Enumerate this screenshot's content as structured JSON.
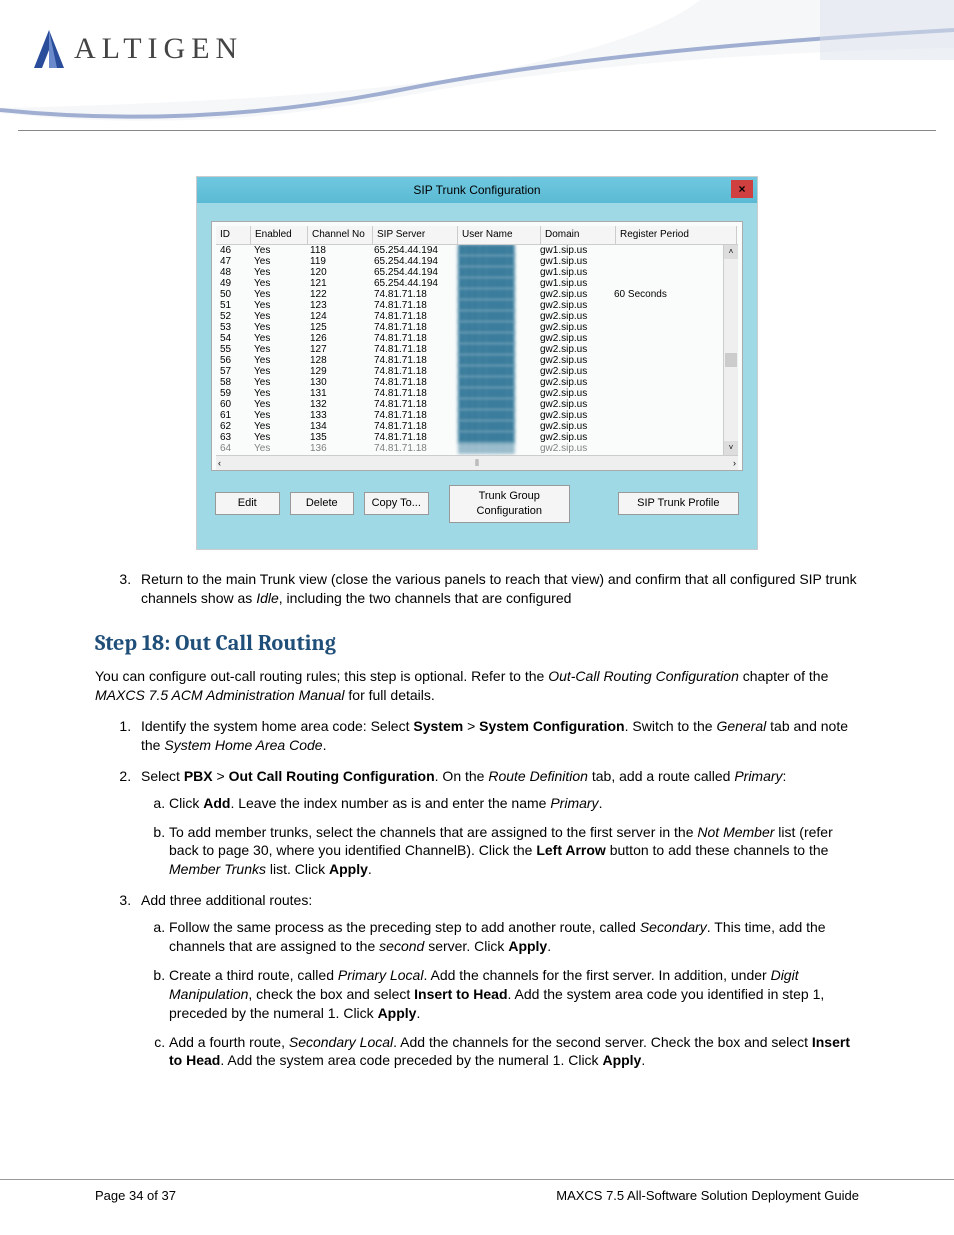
{
  "dialog": {
    "title": "SIP Trunk Configuration",
    "close": "×",
    "columns": [
      "ID",
      "Enabled",
      "Channel No",
      "SIP Server",
      "User Name",
      "Domain",
      "Register Period"
    ],
    "rows": [
      {
        "id": "46",
        "en": "Yes",
        "ch": "118",
        "sip": "65.254.44.194",
        "dom": "gw1.sip.us",
        "reg": ""
      },
      {
        "id": "47",
        "en": "Yes",
        "ch": "119",
        "sip": "65.254.44.194",
        "dom": "gw1.sip.us",
        "reg": ""
      },
      {
        "id": "48",
        "en": "Yes",
        "ch": "120",
        "sip": "65.254.44.194",
        "dom": "gw1.sip.us",
        "reg": ""
      },
      {
        "id": "49",
        "en": "Yes",
        "ch": "121",
        "sip": "65.254.44.194",
        "dom": "gw1.sip.us",
        "reg": ""
      },
      {
        "id": "50",
        "en": "Yes",
        "ch": "122",
        "sip": "74.81.71.18",
        "dom": "gw2.sip.us",
        "reg": "60 Seconds"
      },
      {
        "id": "51",
        "en": "Yes",
        "ch": "123",
        "sip": "74.81.71.18",
        "dom": "gw2.sip.us",
        "reg": ""
      },
      {
        "id": "52",
        "en": "Yes",
        "ch": "124",
        "sip": "74.81.71.18",
        "dom": "gw2.sip.us",
        "reg": ""
      },
      {
        "id": "53",
        "en": "Yes",
        "ch": "125",
        "sip": "74.81.71.18",
        "dom": "gw2.sip.us",
        "reg": ""
      },
      {
        "id": "54",
        "en": "Yes",
        "ch": "126",
        "sip": "74.81.71.18",
        "dom": "gw2.sip.us",
        "reg": ""
      },
      {
        "id": "55",
        "en": "Yes",
        "ch": "127",
        "sip": "74.81.71.18",
        "dom": "gw2.sip.us",
        "reg": ""
      },
      {
        "id": "56",
        "en": "Yes",
        "ch": "128",
        "sip": "74.81.71.18",
        "dom": "gw2.sip.us",
        "reg": ""
      },
      {
        "id": "57",
        "en": "Yes",
        "ch": "129",
        "sip": "74.81.71.18",
        "dom": "gw2.sip.us",
        "reg": ""
      },
      {
        "id": "58",
        "en": "Yes",
        "ch": "130",
        "sip": "74.81.71.18",
        "dom": "gw2.sip.us",
        "reg": ""
      },
      {
        "id": "59",
        "en": "Yes",
        "ch": "131",
        "sip": "74.81.71.18",
        "dom": "gw2.sip.us",
        "reg": ""
      },
      {
        "id": "60",
        "en": "Yes",
        "ch": "132",
        "sip": "74.81.71.18",
        "dom": "gw2.sip.us",
        "reg": ""
      },
      {
        "id": "61",
        "en": "Yes",
        "ch": "133",
        "sip": "74.81.71.18",
        "dom": "gw2.sip.us",
        "reg": ""
      },
      {
        "id": "62",
        "en": "Yes",
        "ch": "134",
        "sip": "74.81.71.18",
        "dom": "gw2.sip.us",
        "reg": ""
      },
      {
        "id": "63",
        "en": "Yes",
        "ch": "135",
        "sip": "74.81.71.18",
        "dom": "gw2.sip.us",
        "reg": ""
      },
      {
        "id": "64",
        "en": "Yes",
        "ch": "136",
        "sip": "74.81.71.18",
        "dom": "gw2.sip.us",
        "reg": ""
      }
    ],
    "buttons": {
      "edit": "Edit",
      "delete": "Delete",
      "copyto": "Copy To...",
      "trunkgroup": "Trunk Group Configuration",
      "profile": "SIP Trunk Profile"
    },
    "scroll": {
      "up": "˄",
      "down": "˅",
      "left": "‹",
      "right": "›",
      "mid": "⦀"
    }
  },
  "body": {
    "item3_a": "Return to the main Trunk view (close the various panels to reach that view) and confirm that all configured SIP trunk channels show as ",
    "item3_idle": "Idle",
    "item3_b": ", including the two channels that are configured",
    "step_title": "Step 18: Out Call Routing",
    "intro_a": "You can configure out-call routing rules; this step is optional. Refer to the ",
    "intro_i": "Out-Call Routing Configuration",
    "intro_b": " chapter of the ",
    "intro_i2": "MAXCS 7.5 ACM Administration Manual",
    "intro_c": " for full details.",
    "li1_a": "Identify the system home area code: Select ",
    "li1_b1": "System",
    "li1_gt": " > ",
    "li1_b2": "System Configuration",
    "li1_b": ". Switch to the ",
    "li1_i": "General",
    "li1_c": " tab and note the ",
    "li1_i2": "System Home Area Code",
    "li1_d": ".",
    "li2_a": "Select ",
    "li2_b1": "PBX",
    "li2_b": " > ",
    "li2_b2": "Out Call Routing Configuration",
    "li2_c": ". On the ",
    "li2_i": "Route Definition",
    "li2_d": " tab, add a route called ",
    "li2_i2": "Primary",
    "li2_e": ":",
    "li2a_a": "Click ",
    "li2a_b": "Add",
    "li2a_c": ". Leave the index number as is and enter the name ",
    "li2a_i": "Primary",
    "li2a_d": ".",
    "li2b_a": "To add member trunks, select the channels that are assigned to the first server in the ",
    "li2b_i": "Not Member",
    "li2b_b": " list (refer back to page 30, where you identified ChannelB).  Click the ",
    "li2b_bold": "Left Arrow",
    "li2b_c": " button to add these channels to the ",
    "li2b_i2": "Member Trunks",
    "li2b_d": " list. Click ",
    "li2b_bold2": "Apply",
    "li2b_e": ".",
    "li3": "Add three additional routes:",
    "li3a_a": "Follow the same process as the preceding step to add another route, called ",
    "li3a_i": "Secondary",
    "li3a_b": ". This time, add the channels that are assigned to the ",
    "li3a_i2": "second",
    "li3a_c": " server.  Click ",
    "li3a_bold": "Apply",
    "li3a_d": ".",
    "li3b_a": "Create a third route, called ",
    "li3b_i": "Primary Local",
    "li3b_b": ". Add the channels for the first server. In addition, under ",
    "li3b_i2": "Digit Manipulation",
    "li3b_c": ", check the box and select ",
    "li3b_bold": "Insert to Head",
    "li3b_d": ". Add the system area code you identified in step 1, preceded by the numeral 1. Click ",
    "li3b_bold2": "Apply",
    "li3b_e": ".",
    "li3c_a": "Add a fourth route, ",
    "li3c_i": "Secondary Local",
    "li3c_b": ". Add the channels for the second server. Check the box and select ",
    "li3c_bold": "Insert to Head",
    "li3c_c": ". Add the system area code preceded by the numeral 1. Click ",
    "li3c_bold2": "Apply",
    "li3c_d": "."
  },
  "footer": {
    "left": "Page 34 of 37",
    "right": "MAXCS 7.5 All-Software Solution Deployment Guide"
  },
  "logo": "ALTIGEN"
}
